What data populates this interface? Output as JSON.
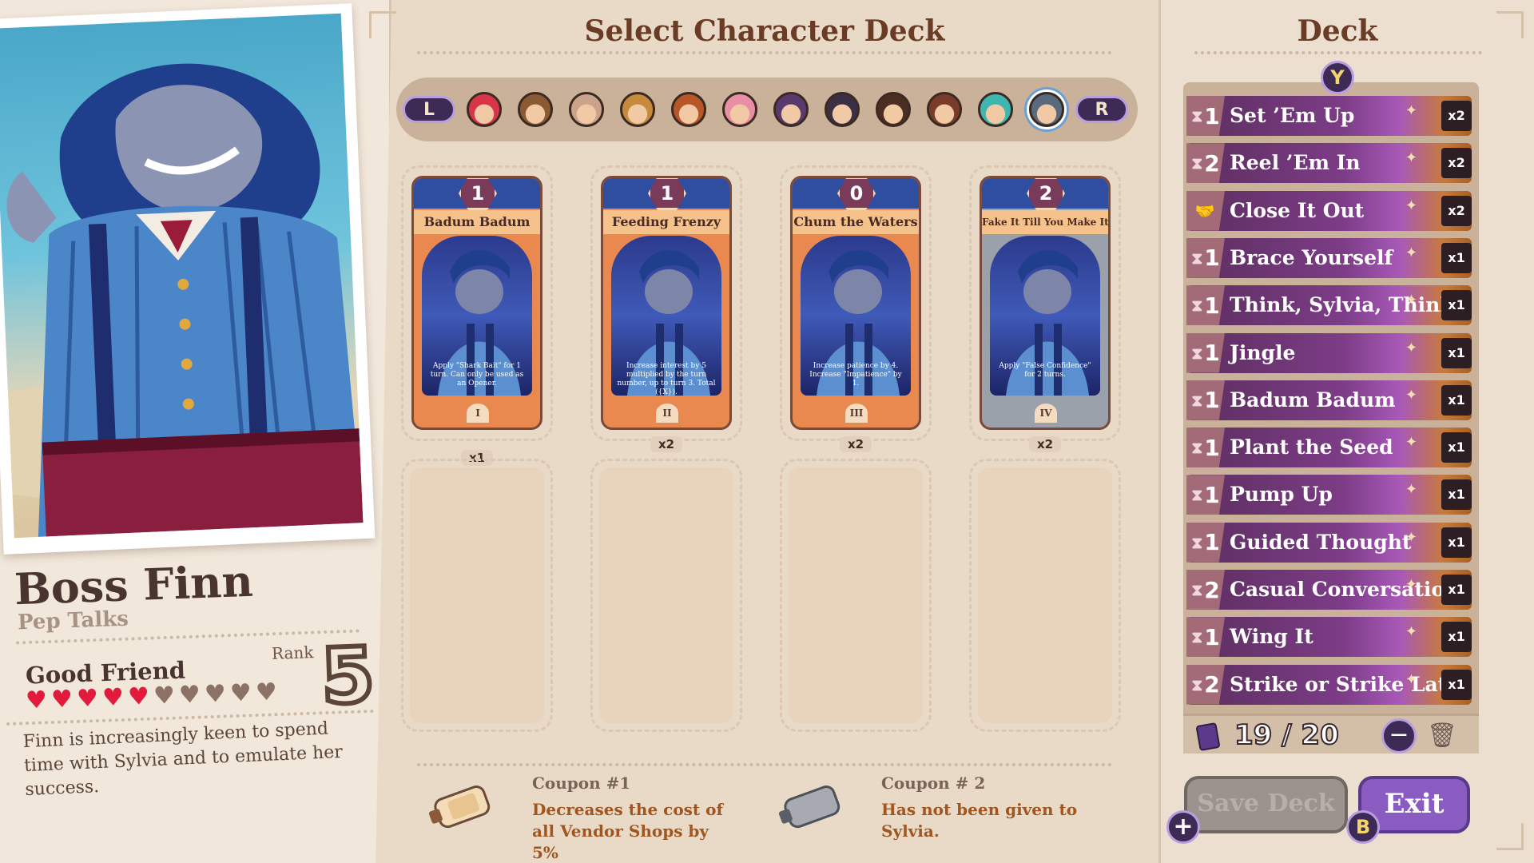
{
  "profile": {
    "name": "Boss Finn",
    "subtitle": "Pep Talks",
    "relationship": "Good Friend",
    "rank_label": "Rank",
    "rank_value": "5",
    "hearts_filled": 5,
    "hearts_total": 10,
    "description": "Finn is increasingly keen to spend time with Sylvia and to emulate her success."
  },
  "center": {
    "title": "Select Character Deck",
    "left_bumper": "L",
    "right_bumper": "R",
    "characters": [
      {
        "icon": "red-haired-character-avatar",
        "color": "#d9354a"
      },
      {
        "icon": "goggles-character-avatar",
        "color": "#8a5a32"
      },
      {
        "icon": "antlered-character-avatar",
        "color": "#c9a38c"
      },
      {
        "icon": "sack-character-avatar",
        "color": "#c68a3c"
      },
      {
        "icon": "curly-haired-character-avatar",
        "color": "#b8562a"
      },
      {
        "icon": "pink-cone-character-avatar",
        "color": "#e88fa6"
      },
      {
        "icon": "witch-hat-character-avatar",
        "color": "#5a3a6e"
      },
      {
        "icon": "cat-pair-character-avatar",
        "color": "#3a2f44"
      },
      {
        "icon": "dark-haired-character-avatar",
        "color": "#4a2e22"
      },
      {
        "icon": "hat-character-avatar",
        "color": "#7a3b2a"
      },
      {
        "icon": "teal-haired-character-avatar",
        "color": "#3fb7b0"
      },
      {
        "icon": "shark-character-avatar",
        "color": "#5a6a7e"
      }
    ],
    "selected_character_index": 11,
    "cards": [
      {
        "name": "Badum Badum",
        "cost": "1",
        "text": "Apply \"Shark Bait\" for 1 turn. Can only be used as an Opener.",
        "numeral": "I",
        "qty": "x1",
        "grey": false
      },
      {
        "name": "Feeding Frenzy",
        "cost": "1",
        "text": "Increase interest by 5 multiplied by the turn number, up to turn 3. Total ({X}).",
        "numeral": "II",
        "qty": "x2",
        "grey": false
      },
      {
        "name": "Chum the Waters",
        "cost": "0",
        "text": "Increase patience by 4. Increase \"Impatience\" by 1.",
        "numeral": "III",
        "qty": "x2",
        "grey": false
      },
      {
        "name": "Fake It Till You Make It",
        "cost": "2",
        "text": "Apply \"False Confidence\" for 2 turns.",
        "numeral": "IV",
        "qty": "x2",
        "grey": true
      }
    ],
    "coupons": [
      {
        "title": "Coupon #1",
        "body": "Decreases the cost of all Vendor Shops by 5%"
      },
      {
        "title": "Coupon # 2",
        "body": "Has not been given to Sylvia."
      }
    ]
  },
  "deck": {
    "title": "Deck",
    "y_button": "Y",
    "items": [
      {
        "cost": "1",
        "name": "Set ’Em Up",
        "qty": "x2",
        "icon": "hourglass-icon"
      },
      {
        "cost": "2",
        "name": "Reel ’Em In",
        "qty": "x2",
        "icon": "hourglass-icon"
      },
      {
        "cost": "",
        "name": "Close It Out",
        "qty": "x2",
        "icon": "handshake-icon"
      },
      {
        "cost": "1",
        "name": "Brace Yourself",
        "qty": "x1",
        "icon": "hourglass-icon"
      },
      {
        "cost": "1",
        "name": "Think, Sylvia, Think",
        "qty": "x1",
        "icon": "hourglass-icon"
      },
      {
        "cost": "1",
        "name": "Jingle",
        "qty": "x1",
        "icon": "hourglass-icon"
      },
      {
        "cost": "1",
        "name": "Badum Badum",
        "qty": "x1",
        "icon": "hourglass-icon"
      },
      {
        "cost": "1",
        "name": "Plant the Seed",
        "qty": "x1",
        "icon": "hourglass-icon"
      },
      {
        "cost": "1",
        "name": "Pump Up",
        "qty": "x1",
        "icon": "hourglass-icon"
      },
      {
        "cost": "1",
        "name": "Guided Thought",
        "qty": "x1",
        "icon": "hourglass-icon"
      },
      {
        "cost": "2",
        "name": "Casual Conversation",
        "qty": "x1",
        "icon": "hourglass-icon"
      },
      {
        "cost": "1",
        "name": "Wing It",
        "qty": "x1",
        "icon": "hourglass-icon"
      },
      {
        "cost": "2",
        "name": "Strike or Strike Later",
        "qty": "x1",
        "icon": "hourglass-icon"
      }
    ],
    "count": "19 / 20",
    "save_label": "Save Deck",
    "exit_label": "Exit",
    "plus_button": "+",
    "b_button": "B",
    "minus_button": "−"
  },
  "colors": {
    "background": "#e9dac8",
    "title": "#6a3c25",
    "heart_full": "#e21b3c",
    "heart_empty": "#8b7264",
    "accent_purple": "#8a5bc0",
    "coupon_text": "#a0561e"
  }
}
